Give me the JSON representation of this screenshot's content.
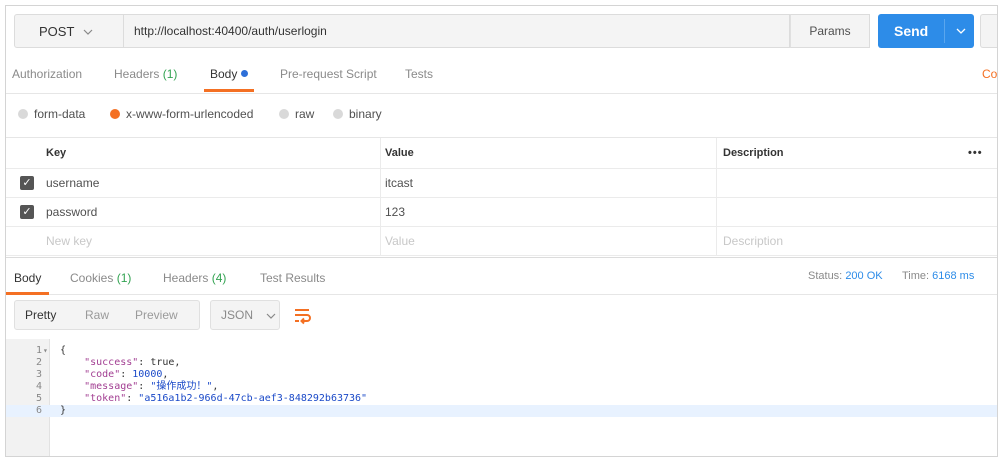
{
  "request": {
    "method": "POST",
    "url": "http://localhost:40400/auth/userlogin",
    "params_label": "Params",
    "send_label": "Send"
  },
  "request_tabs": [
    {
      "label": "Authorization",
      "count": ""
    },
    {
      "label": "Headers",
      "count": "(1)"
    },
    {
      "label": "Body",
      "count": ""
    },
    {
      "label": "Pre-request Script",
      "count": ""
    },
    {
      "label": "Tests",
      "count": ""
    }
  ],
  "cutoff_text": "Co",
  "body_types": [
    "form-data",
    "x-www-form-urlencoded",
    "raw",
    "binary"
  ],
  "selected_body_type": "x-www-form-urlencoded",
  "kv_table": {
    "headers": {
      "key": "Key",
      "value": "Value",
      "description": "Description",
      "more": "•••"
    },
    "rows": [
      {
        "key": "username",
        "value": "itcast",
        "description": "",
        "checked": true
      },
      {
        "key": "password",
        "value": "123",
        "description": "",
        "checked": true
      }
    ],
    "placeholders": {
      "key": "New key",
      "value": "Value",
      "description": "Description"
    }
  },
  "response_tabs": [
    {
      "label": "Body",
      "count": ""
    },
    {
      "label": "Cookies",
      "count": "(1)"
    },
    {
      "label": "Headers",
      "count": "(4)"
    },
    {
      "label": "Test Results",
      "count": ""
    }
  ],
  "response_status": {
    "status_label": "Status:",
    "status_value": "200 OK",
    "time_label": "Time:",
    "time_value": "6168 ms"
  },
  "view_modes": [
    "Pretty",
    "Raw",
    "Preview"
  ],
  "format": "JSON",
  "code_lines": [
    {
      "num": "1",
      "fold": "▾"
    },
    {
      "num": "2"
    },
    {
      "num": "3"
    },
    {
      "num": "4"
    },
    {
      "num": "5"
    },
    {
      "num": "6"
    }
  ],
  "response_json": {
    "open": "{",
    "success_key": "\"success\"",
    "success_val": "true",
    "code_key": "\"code\"",
    "code_val": "10000",
    "message_key": "\"message\"",
    "message_val": "\"操作成功！\"",
    "token_key": "\"token\"",
    "token_val": "\"a516a1b2-966d-47cb-aef3-848292b63736\"",
    "close": "}"
  },
  "colors": {
    "accent": "#f47023",
    "send": "#2d8ce8",
    "count": "#33a352",
    "status": "#2d8ce8"
  }
}
